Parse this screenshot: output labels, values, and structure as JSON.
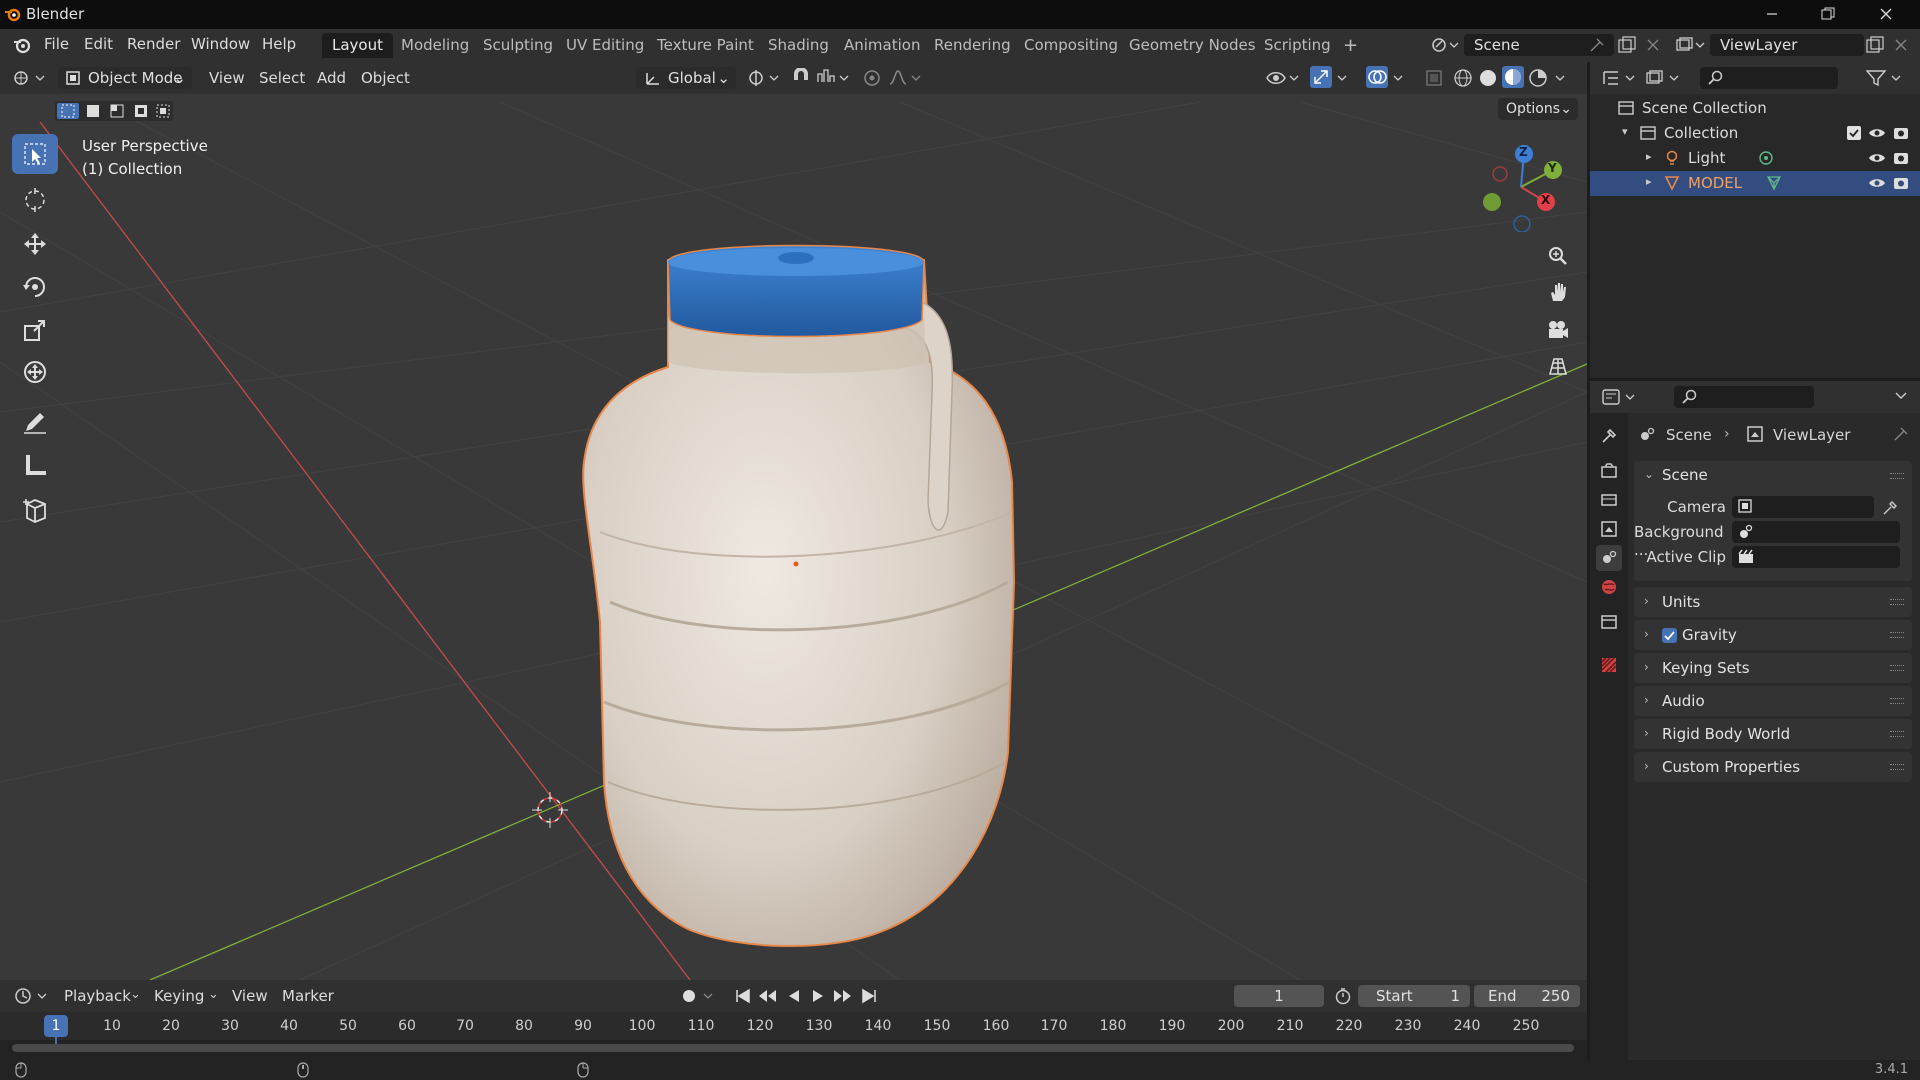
{
  "window": {
    "title": "Blender",
    "controls": [
      "minimize-icon",
      "maximize-icon",
      "close-icon"
    ]
  },
  "menu": {
    "items": [
      "File",
      "Edit",
      "Render",
      "Window",
      "Help"
    ]
  },
  "workspaces": {
    "tabs": [
      "Layout",
      "Modeling",
      "Sculpting",
      "UV Editing",
      "Texture Paint",
      "Shading",
      "Animation",
      "Rendering",
      "Compositing",
      "Geometry Nodes",
      "Scripting"
    ],
    "active": "Layout",
    "add_label": "+"
  },
  "scene_selector": {
    "value": "Scene"
  },
  "viewlayer_selector": {
    "value": "ViewLayer"
  },
  "viewport_header": {
    "mode": "Object Mode",
    "menus": [
      "View",
      "Select",
      "Add",
      "Object"
    ],
    "transform_orientation": "Global",
    "options_label": "Options"
  },
  "viewport": {
    "perspective_label": "User Perspective",
    "collection_label": "(1) Collection",
    "gizmo_axes": {
      "z": "Z",
      "y": "Y",
      "x": "X"
    }
  },
  "outliner": {
    "root": "Scene Collection",
    "collection": "Collection",
    "items": [
      {
        "name": "Light",
        "selected": false
      },
      {
        "name": "MODEL",
        "selected": true
      }
    ]
  },
  "properties": {
    "breadcrumb": {
      "scene": "Scene",
      "viewlayer": "ViewLayer"
    },
    "scene_panel": {
      "title": "Scene",
      "fields": [
        {
          "label": "Camera",
          "value": ""
        },
        {
          "label": "Background ...",
          "value": ""
        },
        {
          "label": "Active Clip",
          "value": ""
        }
      ]
    },
    "collapsed_panels": [
      {
        "label": "Units",
        "checkbox": false
      },
      {
        "label": "Gravity",
        "checkbox": true,
        "checked": true
      },
      {
        "label": "Keying Sets",
        "checkbox": false
      },
      {
        "label": "Audio",
        "checkbox": false
      },
      {
        "label": "Rigid Body World",
        "checkbox": false
      },
      {
        "label": "Custom Properties",
        "checkbox": false
      }
    ]
  },
  "timeline": {
    "menus": [
      "Playback",
      "Keying",
      "View",
      "Marker"
    ],
    "current_frame": "1",
    "start_label": "Start",
    "start_value": "1",
    "end_label": "End",
    "end_value": "250",
    "ruler": [
      "1",
      "10",
      "20",
      "30",
      "40",
      "50",
      "60",
      "70",
      "80",
      "90",
      "100",
      "110",
      "120",
      "130",
      "140",
      "150",
      "160",
      "170",
      "180",
      "190",
      "200",
      "210",
      "220",
      "230",
      "240",
      "250"
    ]
  },
  "status": {
    "version": "3.4.1"
  },
  "colors": {
    "accent": "#4772b3",
    "selection_outline": "#e8874a",
    "x_axis": "#c94a4a",
    "y_axis": "#7fae3a",
    "z_axis": "#3d7fd6",
    "lid": "#2d6fbf"
  }
}
